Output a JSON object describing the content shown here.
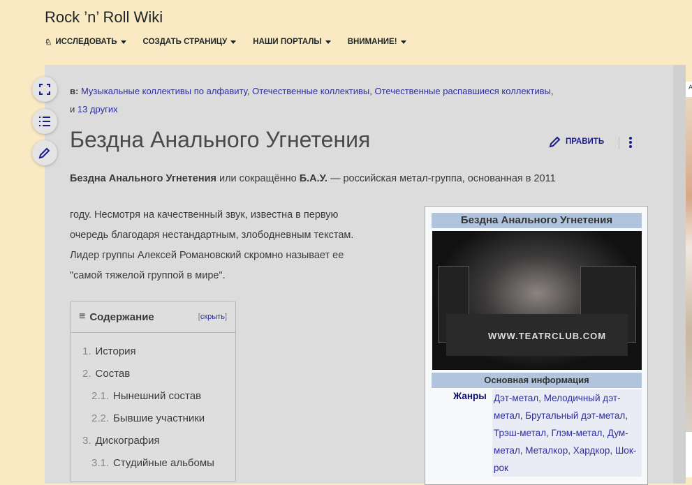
{
  "site": {
    "title": "Rock ’n’ Roll Wiki"
  },
  "nav": [
    {
      "label": "ИССЛЕДОВАТЬ",
      "icon": "explore-icon"
    },
    {
      "label": "СОЗДАТЬ СТРАНИЦУ"
    },
    {
      "label": "НАШИ ПОРТАЛЫ"
    },
    {
      "label": "ВНИМАНИЕ!"
    }
  ],
  "categories": {
    "prefix": "в:",
    "links": [
      "Музыкальные коллективы по алфавиту",
      "Отечественные коллективы",
      "Отечественные распавшиеся коллективы"
    ],
    "and": "и",
    "more": "13 других"
  },
  "page": {
    "title": "Бездна Анального Угнетения",
    "edit_label": "ПРАВИТЬ"
  },
  "intro": {
    "bold1": "Бездна Анального Угнетения",
    "t1": " или сокращённо ",
    "bold2": "Б.А.У.",
    "t2": " — российская метал-группа, основанная в 2011",
    "lines": [
      "году. Несмотря на качественный звук, известна в первую",
      "очередь благодаря нестандартным, злободневным текстам.",
      "Лидер группы Алексей Романовский скромно называет ее",
      "\"самой тяжелой группой в мире\"."
    ]
  },
  "toc": {
    "title": "Содержание",
    "hide": "скрыть",
    "items": [
      {
        "n": "1.",
        "label": "История"
      },
      {
        "n": "2.",
        "label": "Состав"
      },
      {
        "n": "2.1.",
        "label": "Нынешний состав"
      },
      {
        "n": "2.2.",
        "label": "Бывшие участники"
      },
      {
        "n": "3.",
        "label": "Дискография"
      },
      {
        "n": "3.1.",
        "label": "Студийные альбомы"
      }
    ]
  },
  "infobox": {
    "title": "Бездна Анального Угнетения",
    "photo_watermark": "WWW.TEATRCLUB.COM",
    "section": "Основная информация",
    "genres_label": "Жанры",
    "genres": [
      "Дэт-метал",
      "Мелодичный дэт-метал",
      "Брутальный дэт-метал",
      "Трэш-метал",
      "Глэм-метал",
      "Дум-метал",
      "Металкор",
      "Хардкор",
      "Шок-рок"
    ]
  },
  "right_panel": {
    "label": "A"
  }
}
